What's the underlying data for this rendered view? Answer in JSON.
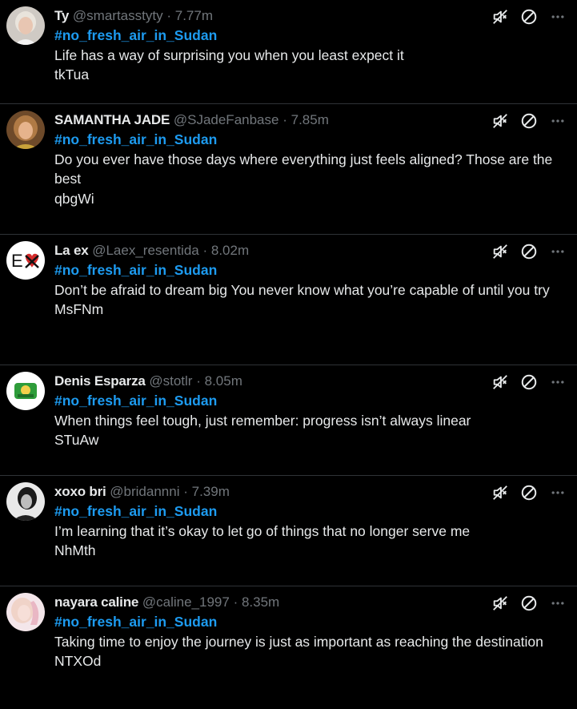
{
  "colors": {
    "background": "#000000",
    "hashtag": "#1d9bf0",
    "muted_text": "#71767b",
    "primary_text": "#e7e9ea",
    "divider": "#2f3336"
  },
  "icons": {
    "mute": "speaker-mute-icon",
    "block": "block-icon",
    "more": "more-horizontal-icon"
  },
  "separator": "·",
  "posts": [
    {
      "name": "Ty",
      "handle": "@smartasstyty",
      "time": "7.77m",
      "hashtag": "#no_fresh_air_in_Sudan",
      "text": "Life has a way of surprising you when you least expect it",
      "code": "tkTua",
      "avatar": "avatar-person-light-hair"
    },
    {
      "name": "SAMANTHA JADE",
      "handle": "@SJadeFanbase",
      "time": "7.85m",
      "hashtag": "#no_fresh_air_in_Sudan",
      "text": "Do you ever have those days where everything just feels aligned? Those are the best",
      "code": "qbgWi",
      "avatar": "avatar-person-warm"
    },
    {
      "name": "La ex",
      "handle": "@Laex_resentida",
      "time": "8.02m",
      "hashtag": "#no_fresh_air_in_Sudan",
      "text": "Don’t be afraid to dream big You never know what you’re capable of until you try",
      "code": "MsFNm",
      "avatar": "avatar-ex-heart-logo"
    },
    {
      "name": "Denis Esparza",
      "handle": "@stotlr",
      "time": "8.05m",
      "hashtag": "#no_fresh_air_in_Sudan",
      "text": "When things feel tough, just remember: progress isn’t always linear",
      "code": "STuAw",
      "avatar": "avatar-green-badge"
    },
    {
      "name": "xoxo bri",
      "handle": "@bridannni",
      "time": "7.39m",
      "hashtag": "#no_fresh_air_in_Sudan",
      "text": "I’m learning that it’s okay to let go of things that no longer serve me",
      "code": "NhMth",
      "avatar": "avatar-person-monochrome"
    },
    {
      "name": "nayara caline",
      "handle": "@caline_1997",
      "time": "8.35m",
      "hashtag": "#no_fresh_air_in_Sudan",
      "text": "Taking time to enjoy the journey is just as important as reaching the destination",
      "code": "NTXOd",
      "avatar": "avatar-person-pink"
    }
  ]
}
